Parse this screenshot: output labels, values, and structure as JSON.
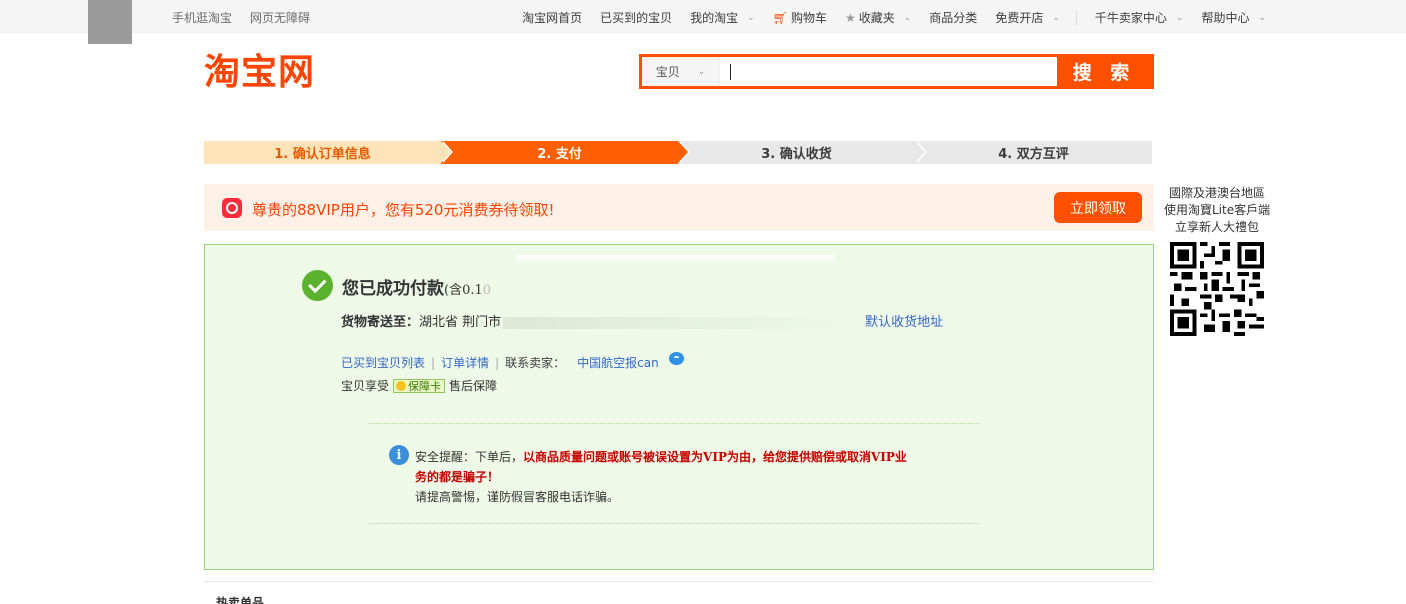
{
  "topbar": {
    "left_links": [
      "手机逛淘宝",
      "网页无障碍"
    ],
    "links": {
      "home": "淘宝网首页",
      "bought": "已买到的宝贝",
      "my_taobao": "我的淘宝",
      "cart": "购物车",
      "favorites": "收藏夹",
      "categories": "商品分类",
      "open_store": "免费开店",
      "seller_center": "千牛卖家中心",
      "help": "帮助中心"
    }
  },
  "header": {
    "logo": "淘宝网",
    "search": {
      "type_label": "宝贝",
      "value": "",
      "button": "搜 索"
    }
  },
  "steps": [
    {
      "label": "1. 确认订单信息",
      "state": "done"
    },
    {
      "label": "2. 支付",
      "state": "current"
    },
    {
      "label": "3. 确认收货",
      "state": "todo"
    },
    {
      "label": "4. 双方互评",
      "state": "todo"
    }
  ],
  "vip_banner": {
    "text": "尊贵的88VIP用户，您有520元消费券待领取!",
    "button": "立即领取"
  },
  "success": {
    "title": "您已成功付款",
    "title_sub": "(含0.1",
    "title_fade": "0",
    "address_label": "货物寄送至：",
    "address_value": "湖北省 荆门市",
    "address_link": "默认收货地址",
    "links": {
      "bought_list": "已买到宝贝列表",
      "order_detail": "订单详情",
      "contact_label": "联系卖家：",
      "seller_name": "中国航空报can"
    },
    "protect": {
      "prefix": "宝贝享受",
      "card": "保障卡",
      "suffix": "售后保障"
    },
    "tip": {
      "prefix": "安全提醒：下单后，",
      "red": "以商品质量问题或账号被误设置为VIP为由，给您提供赔偿或取消VIP业务的都是骗子！",
      "line2": "请提高警惕，谨防假冒客服电话诈骗。"
    }
  },
  "qr_panel": {
    "line1": "國際及港澳台地區",
    "line2": "使用淘寶Lite客戶端",
    "line3": "立享新人大禮包"
  },
  "bottom": {
    "hot": "热卖单品"
  },
  "colors": {
    "brand": "#ff5000",
    "success_bg": "#eef9e8",
    "success_border": "#9bd37b",
    "link": "#3366cc"
  }
}
